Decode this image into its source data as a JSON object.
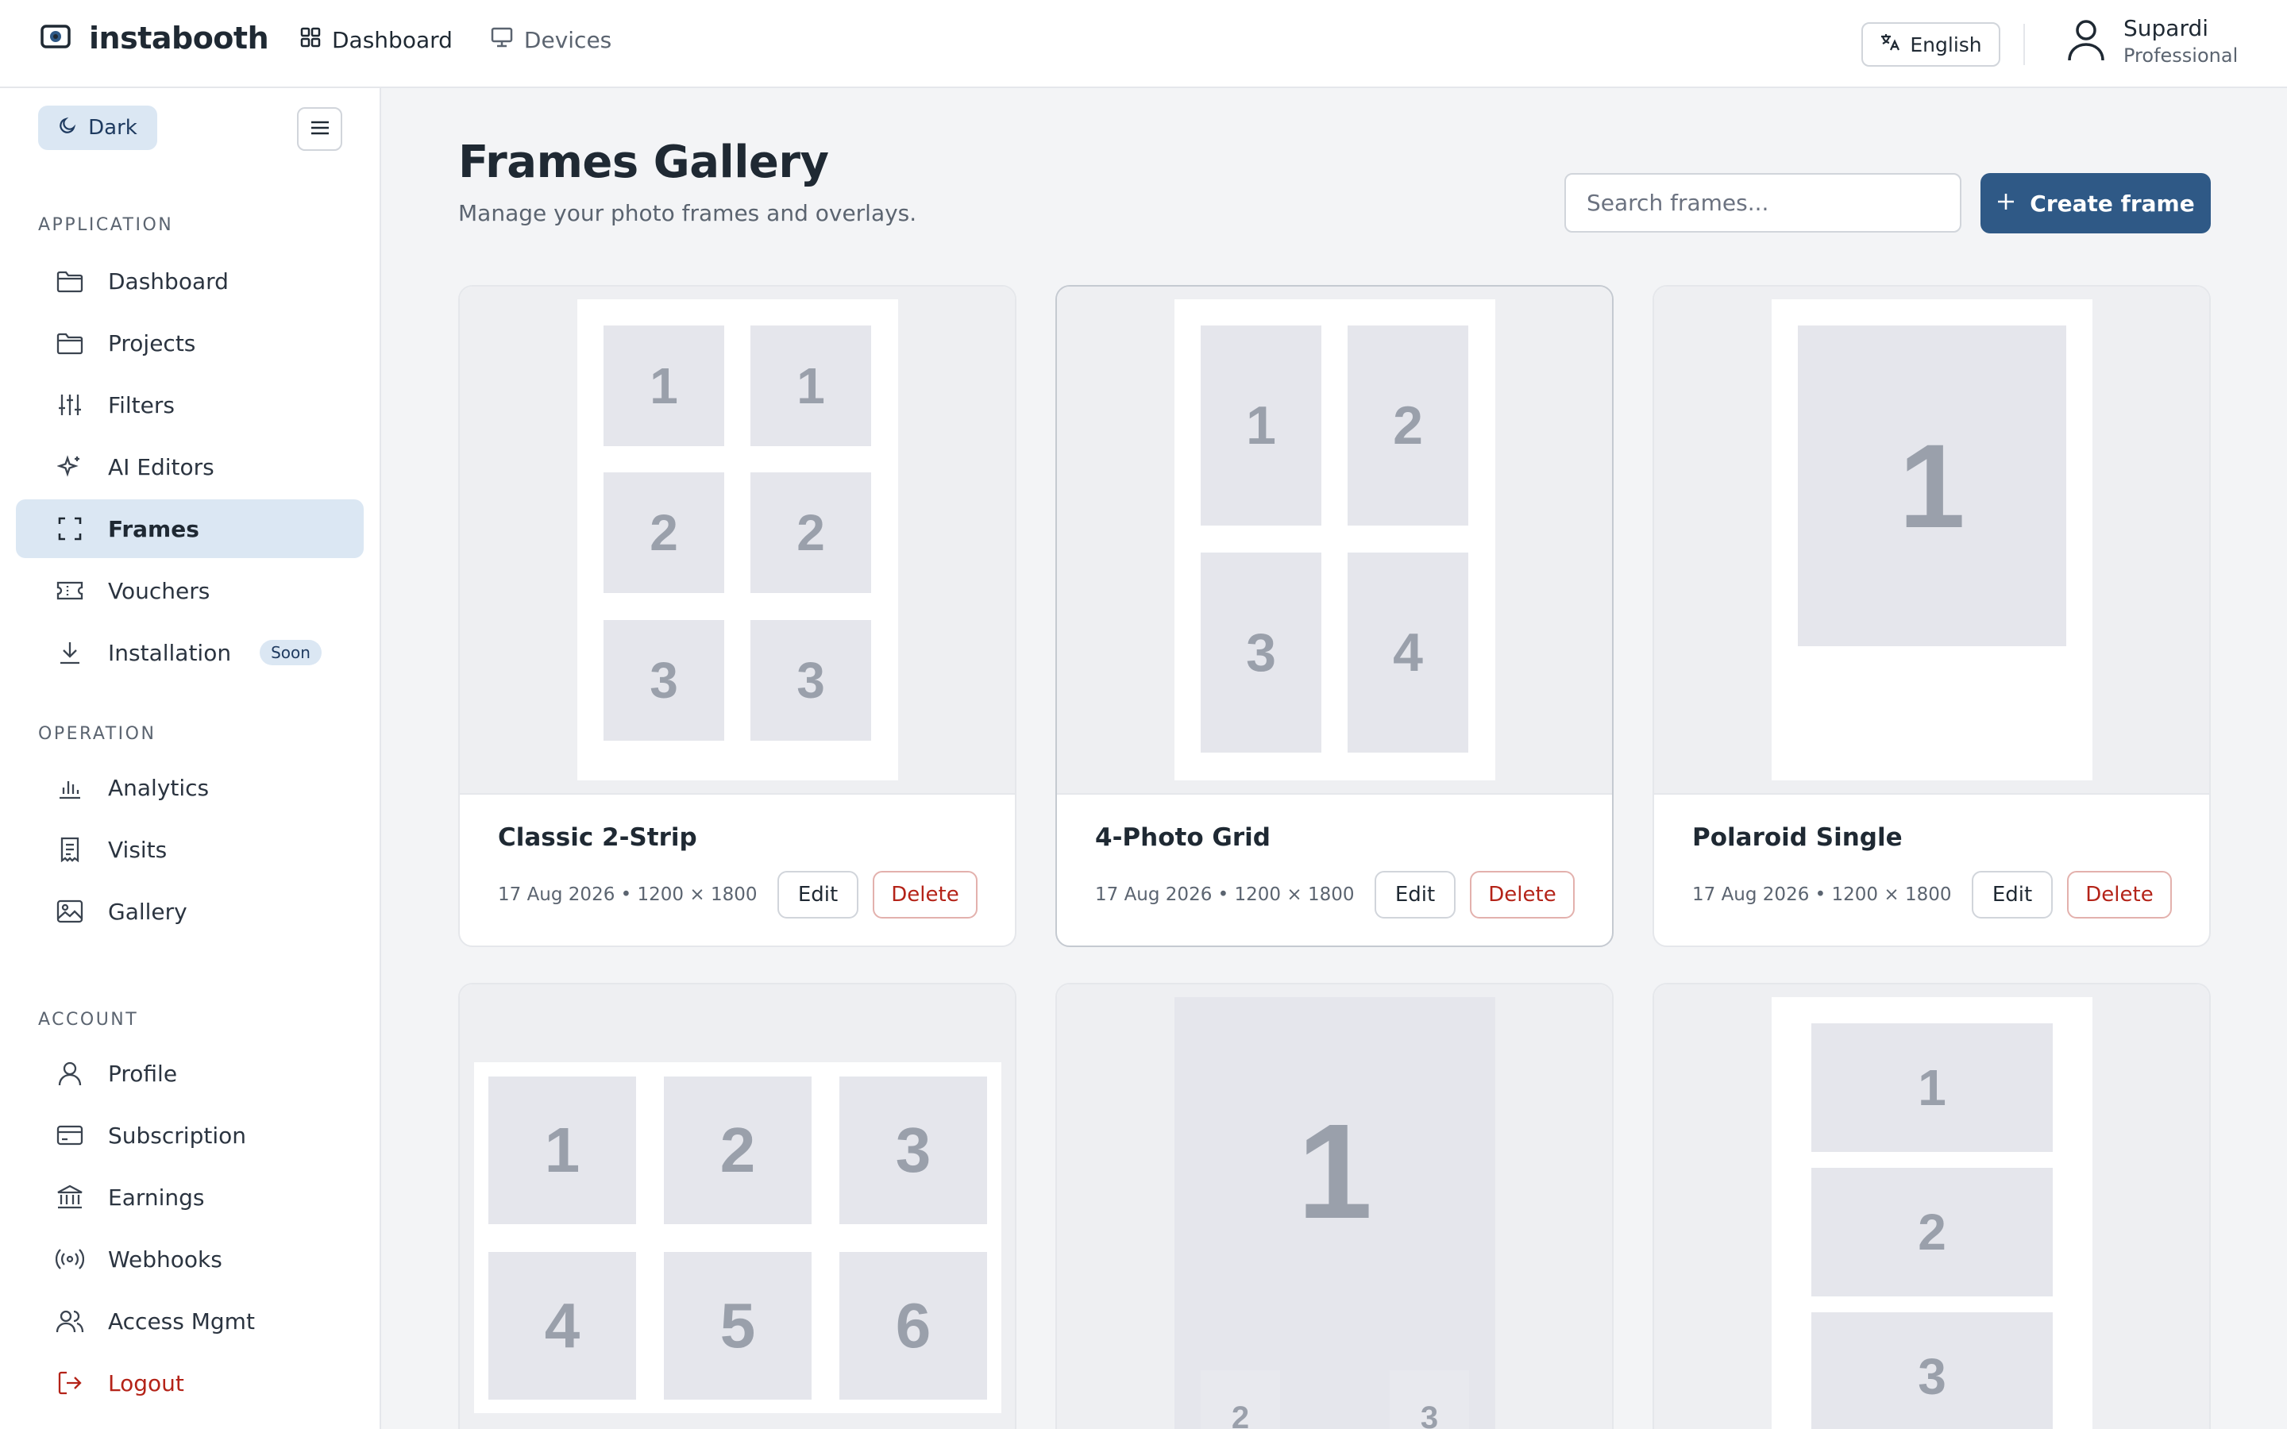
{
  "app": {
    "brand": "instabooth",
    "nav": [
      {
        "label": "Dashboard",
        "icon": "grid-icon"
      },
      {
        "label": "Devices",
        "icon": "monitor-icon"
      }
    ],
    "language": "English",
    "user": {
      "name": "Supardi",
      "plan": "Professional"
    }
  },
  "sidebar": {
    "theme_label": "Dark",
    "sections": {
      "application": "APPLICATION",
      "operation": "OPERATION",
      "account": "ACCOUNT"
    },
    "items": {
      "dashboard": "Dashboard",
      "projects": "Projects",
      "filters": "Filters",
      "ai_editors": "AI Editors",
      "frames": "Frames",
      "vouchers": "Vouchers",
      "installation": "Installation",
      "installation_badge": "Soon",
      "analytics": "Analytics",
      "visits": "Visits",
      "gallery": "Gallery",
      "profile": "Profile",
      "subscription": "Subscription",
      "earnings": "Earnings",
      "webhooks": "Webhooks",
      "access_mgmt": "Access Mgmt",
      "logout": "Logout"
    },
    "active_item": "Frames"
  },
  "main": {
    "title": "Frames Gallery",
    "subtitle": "Manage your photo frames and overlays.",
    "search_placeholder": "Search frames...",
    "create_label": "Create frame",
    "edit_label": "Edit",
    "delete_label": "Delete",
    "cards": [
      {
        "title": "Classic 2-Strip",
        "meta": "17 Aug 2026 • 1200 × 1800",
        "slots": [
          "1",
          "1",
          "2",
          "2",
          "3",
          "3"
        ]
      },
      {
        "title": "4-Photo Grid",
        "meta": "17 Aug 2026 • 1200 × 1800",
        "slots": [
          "1",
          "2",
          "3",
          "4"
        ]
      },
      {
        "title": "Polaroid Single",
        "meta": "17 Aug 2026 • 1200 × 1800",
        "slots": [
          "1"
        ]
      },
      {
        "slots": [
          "1",
          "2",
          "3",
          "4",
          "5",
          "6"
        ]
      },
      {
        "slots": [
          "1",
          "2",
          "3"
        ]
      },
      {
        "slots": [
          "1",
          "2",
          "3"
        ]
      }
    ]
  },
  "colors": {
    "accent": "#2f5986",
    "active_bg": "#dbe7f3",
    "danger": "#b42318",
    "slot_bg": "#e5e6ec",
    "slot_text": "#9aa0ab"
  }
}
